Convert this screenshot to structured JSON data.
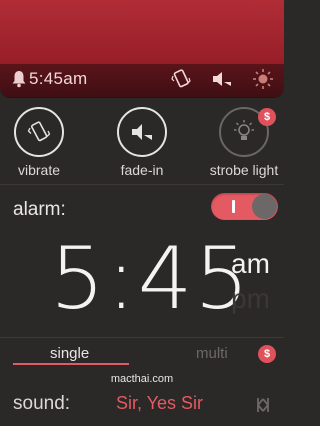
{
  "header": {
    "alarm_time": "5:45am",
    "icons": [
      "bell-icon",
      "vibrate-icon",
      "fade-in-icon",
      "strobe-light-icon"
    ]
  },
  "options": [
    {
      "label": "vibrate",
      "icon": "vibrate-icon",
      "active": true
    },
    {
      "label": "fade-in",
      "icon": "fade-in-icon",
      "active": true
    },
    {
      "label": "strobe light",
      "icon": "strobe-light-icon",
      "active": false,
      "badge": "$"
    }
  ],
  "alarm": {
    "label": "alarm:",
    "enabled": true,
    "time": "5:45",
    "am": "am",
    "pm": "pm",
    "period_selected": "am"
  },
  "tabs": {
    "single": "single",
    "multi": "multi",
    "multi_badge": "$",
    "selected": "single"
  },
  "watermark": "macthai.com",
  "sound": {
    "label": "sound:",
    "value": "Sir, Yes Sir"
  },
  "colors": {
    "accent": "#e45a62",
    "header_red": "#a5242e",
    "background": "#2b2828"
  }
}
